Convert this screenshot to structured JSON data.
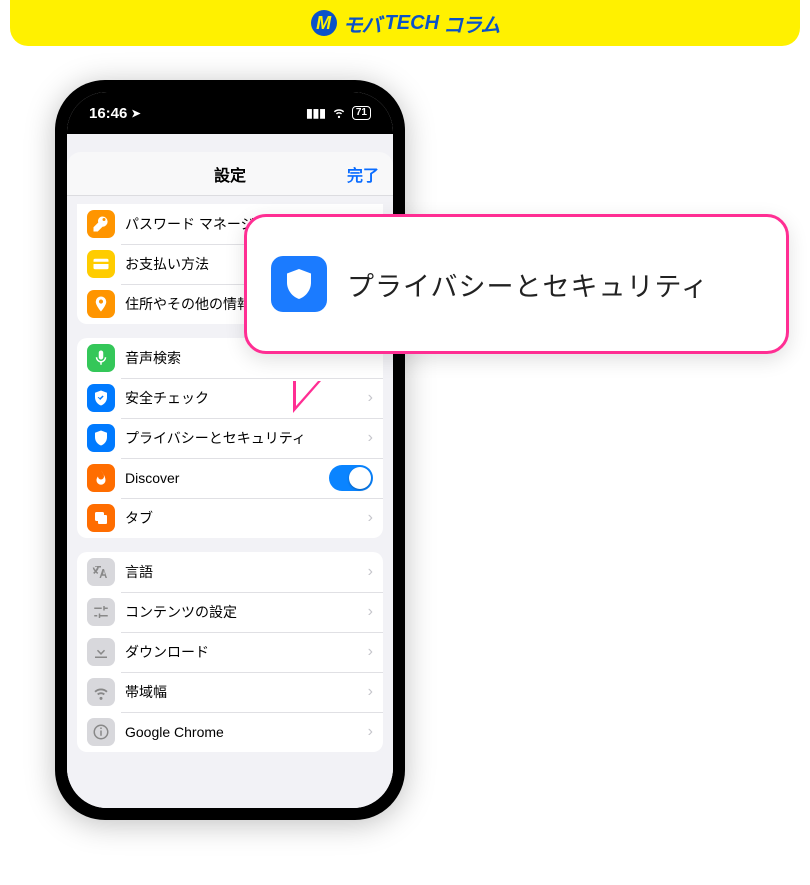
{
  "brand": {
    "logo_letter": "M",
    "text_mo": "モバ",
    "text_tech": "TECH",
    "text_column": "コラム"
  },
  "status": {
    "time": "16:46",
    "battery": "71"
  },
  "nav": {
    "title": "設定",
    "done": "完了"
  },
  "groups": [
    {
      "rows": [
        {
          "icon": "key-icon",
          "color": "ic-orange",
          "label": "パスワード マネージャー",
          "accessory": "chevron"
        },
        {
          "icon": "card-icon",
          "color": "ic-yellow",
          "label": "お支払い方法",
          "accessory": "chevron"
        },
        {
          "icon": "pin-icon",
          "color": "ic-orange",
          "label": "住所やその他の情報",
          "accessory": "chevron"
        }
      ]
    },
    {
      "rows": [
        {
          "icon": "mic-icon",
          "color": "ic-green",
          "label": "音声検索",
          "accessory": "none"
        },
        {
          "icon": "shield-check-icon",
          "color": "ic-blue",
          "label": "安全チェック",
          "accessory": "chevron"
        },
        {
          "icon": "shield-icon",
          "color": "ic-blue",
          "label": "プライバシーとセキュリティ",
          "accessory": "chevron"
        },
        {
          "icon": "flame-icon",
          "color": "ic-flame",
          "label": "Discover",
          "accessory": "toggle-on"
        },
        {
          "icon": "tabs-icon",
          "color": "ic-deeporange",
          "label": "タブ",
          "accessory": "chevron"
        }
      ]
    },
    {
      "rows": [
        {
          "icon": "translate-icon",
          "color": "ic-gray",
          "label": "言語",
          "accessory": "chevron"
        },
        {
          "icon": "sliders-icon",
          "color": "ic-gray",
          "label": "コンテンツの設定",
          "accessory": "chevron"
        },
        {
          "icon": "download-icon",
          "color": "ic-gray",
          "label": "ダウンロード",
          "accessory": "chevron"
        },
        {
          "icon": "wifi-icon",
          "color": "ic-gray",
          "label": "帯域幅",
          "accessory": "chevron"
        },
        {
          "icon": "info-icon",
          "color": "ic-gray",
          "label": "Google Chrome",
          "accessory": "chevron"
        }
      ]
    }
  ],
  "callout": {
    "text": "プライバシーとセキュリティ"
  }
}
